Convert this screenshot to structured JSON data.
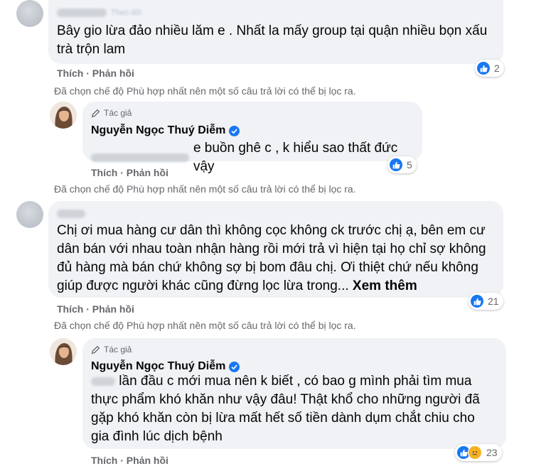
{
  "comments": [
    {
      "text": "Bây gio lừa đảo nhiều lăm e . Nhất la mấy group tại quận nhiều bọn xấu trà trộn lam",
      "like_label": "Thích",
      "reply_label": "Phản hồi",
      "reaction_count": "2",
      "notice": "Đã chọn chế độ Phù hợp nhất nên một số câu trả lời có thể bị lọc ra."
    },
    {
      "author_tag": "Tác giả",
      "author_name": "Nguyễn Ngọc Thuý Diễm",
      "text": "e buồn ghê c , k hiểu sao thất đức vậy",
      "like_label": "Thích",
      "reply_label": "Phản hồi",
      "reaction_count": "5",
      "notice": "Đã chọn chế độ Phù hợp nhất nên một số câu trả lời có thể bị lọc ra."
    },
    {
      "text": "Chị ơi mua hàng cư dân thì không cọc không ck trước chị ạ, bên em cư dân bán với nhau toàn nhận hàng rồi mới trả vì hiện tại họ chỉ sợ không đủ hàng mà bán chứ không sợ bị bom đâu chị. Ơi thiệt chứ nếu không giúp được người khác cũng đừng lọc lừa trong...",
      "see_more": "Xem thêm",
      "like_label": "Thích",
      "reply_label": "Phản hồi",
      "reaction_count": "21",
      "notice": "Đã chọn chế độ Phù hợp nhất nên một số câu trả lời có thể bị lọc ra."
    },
    {
      "author_tag": "Tác giả",
      "author_name": "Nguyễn Ngọc Thuý Diễm",
      "text": "lần đầu c mới mua nên k biết , có bao g mình phải tìm mua thực phẩm khó khăn như vậy đâu! Thật khổ cho những người đã gặp khó khăn còn bị lừa mất hết số tiền dành dụm chắt chiu cho gia đình lúc dịch bệnh",
      "like_label": "Thích",
      "reply_label": "Phản hồi",
      "reaction_count": "23"
    }
  ],
  "colors": {
    "like": "#1877f2",
    "sad": "#f7b125",
    "secondary_text": "#65676b",
    "bubble": "#f0f2f5"
  },
  "icons": [
    "like-icon",
    "sad-icon",
    "pen-icon",
    "verified-badge-icon"
  ]
}
